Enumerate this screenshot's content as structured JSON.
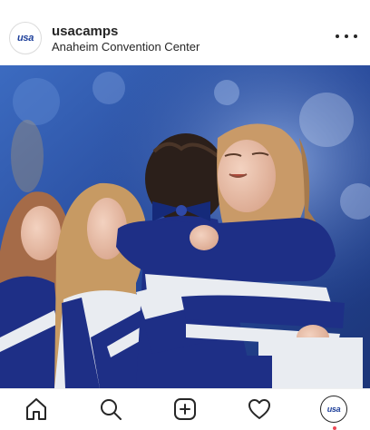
{
  "post": {
    "avatar_text": "usa",
    "username": "usacamps",
    "location": "Anaheim Convention Center"
  },
  "photo": {
    "subject": "cheerleaders-hugging",
    "colors": {
      "backdrop": "#2a4f9e",
      "uniform_navy": "#1e2f86",
      "uniform_white": "#e9ecf1"
    }
  },
  "nav": {
    "items": [
      "home-icon",
      "search-icon",
      "new-post-icon",
      "activity-heart-icon",
      "profile-icon"
    ],
    "profile_text": "usa"
  },
  "colors": {
    "text": "#262626",
    "notification_dot": "#ed4956",
    "brand_blue": "#1d3f9a"
  }
}
